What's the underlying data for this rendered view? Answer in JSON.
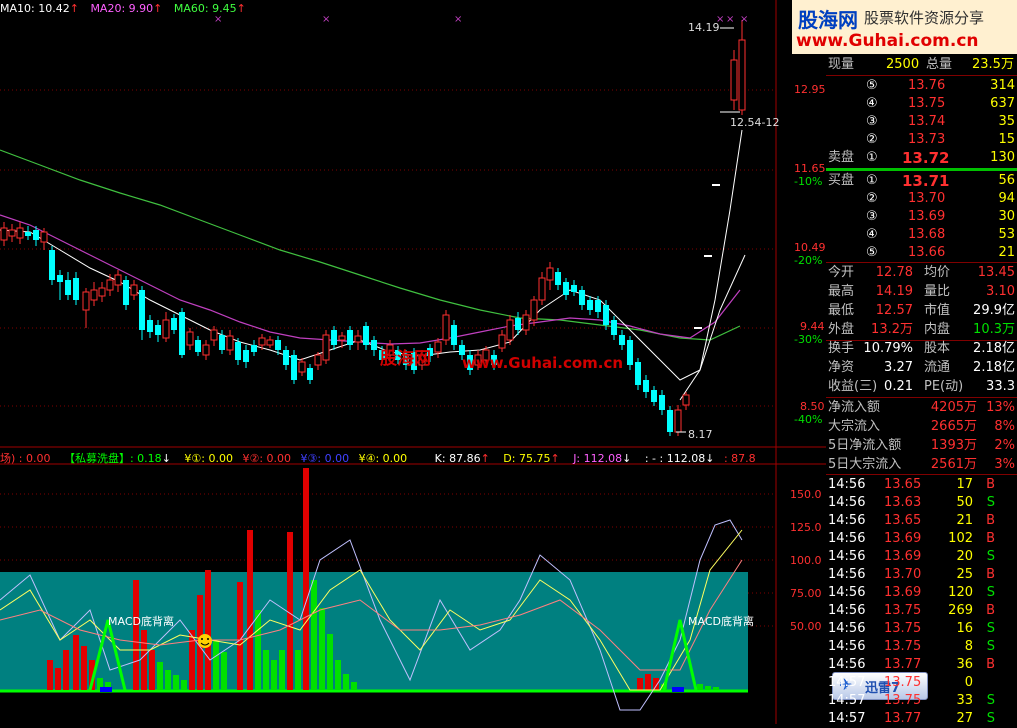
{
  "price_header": {
    "ma10": "MA10: 10.42",
    "ma20": "MA20: 9.90",
    "ma60": "MA60: 9.45"
  },
  "price_axis": {
    "labels": [
      "12.95",
      "11.65",
      "-10%",
      "10.49",
      "-20%",
      "9.44",
      "-30%",
      "8.50",
      "-40%"
    ]
  },
  "price_annotations": {
    "high": "14.19",
    "low": "8.17",
    "range": "12.54-12"
  },
  "indicator_header": {
    "item1": "场) : 0.00",
    "item2": "【私募洗盘】: 0.18",
    "item3": "¥①: 0.00",
    "item4": "¥②: 0.00",
    "item5": "¥③: 0.00",
    "item6": "¥④: 0.00",
    "k": "K: 87.86",
    "d": "D: 75.75",
    "j": "J: 112.08",
    "extra": ": - : 112.08",
    "extra2": ": 87.8"
  },
  "indicator_axis": {
    "labels": [
      "150.0",
      "125.0",
      "100.0",
      "75.00",
      "50.00"
    ]
  },
  "macd_labels": {
    "left": "MACD底背离",
    "right": "MACD底背离"
  },
  "watermarks": {
    "center_a": "股海网",
    "center_b": "www.Guhai.com.cn",
    "logo": "股海网",
    "slogan": "股票软件资源分享",
    "url": "www.Guhai.com.cn"
  },
  "xunlei": {
    "label": "迅雷7"
  },
  "quote": {
    "xianliang_label": "现量",
    "xianliang": "2500",
    "zongliang_label": "总量",
    "zongliang": "23.5万",
    "asks": [
      {
        "level": "⑤",
        "price": "13.76",
        "vol": "314"
      },
      {
        "level": "④",
        "price": "13.75",
        "vol": "637"
      },
      {
        "level": "③",
        "price": "13.74",
        "vol": "35"
      },
      {
        "level": "②",
        "price": "13.73",
        "vol": "15"
      }
    ],
    "ask1_label": "卖盘",
    "ask1": {
      "level": "①",
      "price": "13.72",
      "vol": "130"
    },
    "bid1_label": "买盘",
    "bid1": {
      "level": "①",
      "price": "13.71",
      "vol": "56"
    },
    "bids": [
      {
        "level": "②",
        "price": "13.70",
        "vol": "94"
      },
      {
        "level": "③",
        "price": "13.69",
        "vol": "30"
      },
      {
        "level": "④",
        "price": "13.68",
        "vol": "53"
      },
      {
        "level": "⑤",
        "price": "13.66",
        "vol": "21"
      }
    ]
  },
  "stats": [
    {
      "l1": "今开",
      "v1": "12.78",
      "c1": "red",
      "l2": "均价",
      "v2": "13.45",
      "c2": "red"
    },
    {
      "l1": "最高",
      "v1": "14.19",
      "c1": "red",
      "l2": "量比",
      "v2": "3.10",
      "c2": "red"
    },
    {
      "l1": "最低",
      "v1": "12.57",
      "c1": "red",
      "l2": "市值",
      "v2": "29.9亿",
      "c2": "white"
    },
    {
      "l1": "外盘",
      "v1": "13.2万",
      "c1": "red",
      "l2": "内盘",
      "v2": "10.3万",
      "c2": "green"
    },
    {
      "l1": "换手",
      "v1": "10.79%",
      "c1": "white",
      "l2": "股本",
      "v2": "2.18亿",
      "c2": "white"
    },
    {
      "l1": "净资",
      "v1": "3.27",
      "c1": "white",
      "l2": "流通",
      "v2": "2.18亿",
      "c2": "white"
    },
    {
      "l1": "收益(三)",
      "v1": "0.21",
      "c1": "white",
      "l2": "PE(动)",
      "v2": "33.3",
      "c2": "white"
    }
  ],
  "flows": [
    {
      "label": "净流入额",
      "value": "4205万",
      "pct": "13%"
    },
    {
      "label": "大宗流入",
      "value": "2665万",
      "pct": "8%"
    },
    {
      "label": "5日净流入额",
      "value": "1393万",
      "pct": "2%"
    },
    {
      "label": "5日大宗流入",
      "value": "2561万",
      "pct": "3%"
    }
  ],
  "ticks": [
    {
      "time": "14:56",
      "price": "13.65",
      "vol": "17",
      "bs": "B"
    },
    {
      "time": "14:56",
      "price": "13.63",
      "vol": "50",
      "bs": "S"
    },
    {
      "time": "14:56",
      "price": "13.65",
      "vol": "21",
      "bs": "B"
    },
    {
      "time": "14:56",
      "price": "13.69",
      "vol": "102",
      "bs": "B"
    },
    {
      "time": "14:56",
      "price": "13.69",
      "vol": "20",
      "bs": "S"
    },
    {
      "time": "14:56",
      "price": "13.70",
      "vol": "25",
      "bs": "B"
    },
    {
      "time": "14:56",
      "price": "13.69",
      "vol": "120",
      "bs": "S"
    },
    {
      "time": "14:56",
      "price": "13.75",
      "vol": "269",
      "bs": "B"
    },
    {
      "time": "14:56",
      "price": "13.75",
      "vol": "16",
      "bs": "S"
    },
    {
      "time": "14:56",
      "price": "13.75",
      "vol": "8",
      "bs": "S"
    },
    {
      "time": "14:56",
      "price": "13.77",
      "vol": "36",
      "bs": "B"
    },
    {
      "time": "14:57",
      "price": "13.75",
      "vol": "0",
      "bs": ""
    },
    {
      "time": "14:57",
      "price": "13.75",
      "vol": "33",
      "bs": "S"
    },
    {
      "time": "14:57",
      "price": "13.77",
      "vol": "27",
      "bs": "S"
    }
  ]
}
